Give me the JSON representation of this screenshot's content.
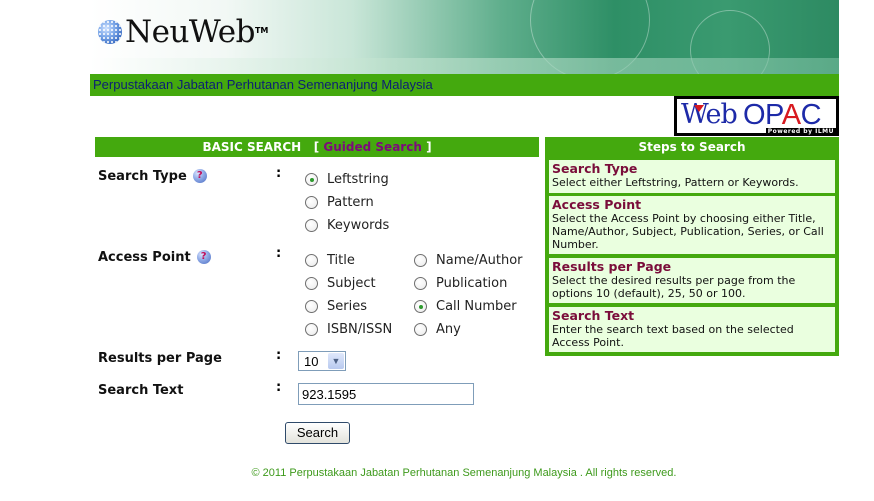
{
  "header": {
    "logo_text": "NeuWeb",
    "logo_tm": "TM",
    "organization": "Perpustakaan Jabatan Perhutanan Semenanjung Malaysia",
    "webopac_logo": {
      "part1": "Web",
      "part2_a": "OP",
      "part2_b": "A",
      "part2_c": "C",
      "powered": "Powered by ILMU"
    }
  },
  "search_panel": {
    "title": "BASIC SEARCH",
    "bracket_open": "[",
    "guided_link": "Guided Search",
    "bracket_close": "]",
    "colon": ":",
    "help_icon": "?",
    "search_type": {
      "label": "Search Type",
      "options": [
        {
          "label": "Leftstring",
          "checked": true
        },
        {
          "label": "Pattern",
          "checked": false
        },
        {
          "label": "Keywords",
          "checked": false
        }
      ]
    },
    "access_point": {
      "label": "Access Point",
      "options": [
        {
          "label": "Title",
          "checked": false
        },
        {
          "label": "Name/Author",
          "checked": false
        },
        {
          "label": "Subject",
          "checked": false
        },
        {
          "label": "Publication",
          "checked": false
        },
        {
          "label": "Series",
          "checked": false
        },
        {
          "label": "Call Number",
          "checked": true
        },
        {
          "label": "ISBN/ISSN",
          "checked": false
        },
        {
          "label": "Any",
          "checked": false
        }
      ]
    },
    "results_per_page": {
      "label": "Results per Page",
      "value": "10"
    },
    "search_text": {
      "label": "Search Text",
      "value": "923.1595"
    },
    "search_button": "Search"
  },
  "steps": {
    "title": "Steps to Search",
    "items": [
      {
        "title": "Search Type",
        "text": "Select either Leftstring, Pattern or Keywords."
      },
      {
        "title": "Access Point",
        "text": "Select the Access Point by choosing either Title, Name/Author, Subject, Publication, Series, or Call Number."
      },
      {
        "title": "Results per Page",
        "text": "Select the desired results per page from the options 10 (default), 25, 50 or 100."
      },
      {
        "title": "Search Text",
        "text": "Enter the search text based on the selected Access Point."
      }
    ]
  },
  "footer": "© 2011 Perpustakaan Jabatan Perhutanan Semenanjung Malaysia . All rights reserved.",
  "colors": {
    "brand_green": "#44a90e",
    "link_purple": "#7d0a7c",
    "step_title": "#7a0d3a",
    "org_text": "#0c1f74"
  }
}
